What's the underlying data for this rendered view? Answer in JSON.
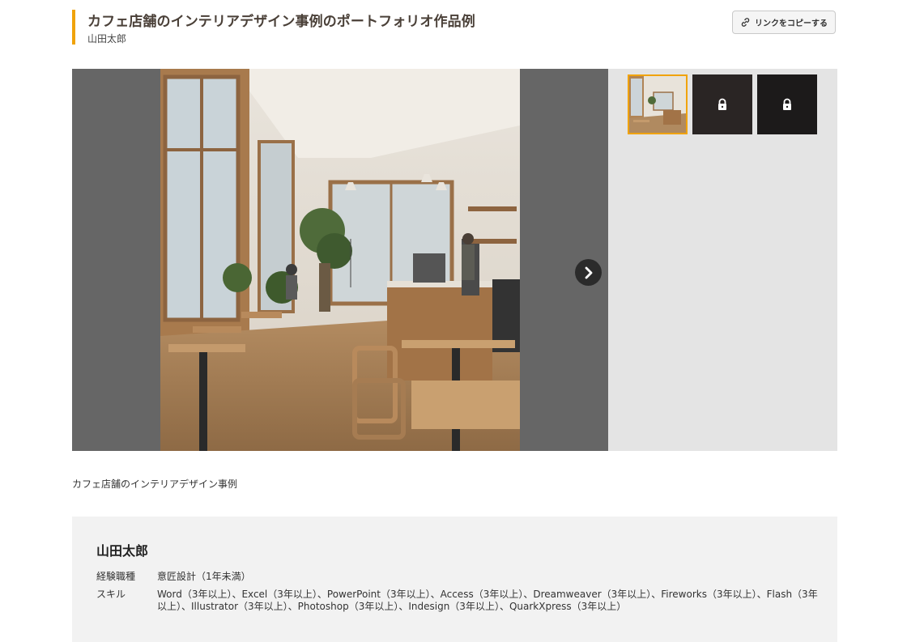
{
  "header": {
    "title": "カフェ店舗のインテリアデザイン事例のポートフォリオ作品例",
    "author": "山田太郎",
    "copy_link_label": "リンクをコピーする"
  },
  "gallery": {
    "main_image_icon": "cafe-interior-photo",
    "next_icon": "chevron-right-icon",
    "thumbnails": [
      {
        "state": "selected",
        "icon": "cafe-interior-thumbnail"
      },
      {
        "state": "locked",
        "icon": "lock-icon"
      },
      {
        "state": "locked",
        "icon": "lock-icon"
      }
    ]
  },
  "caption": "カフェ店舗のインテリアデザイン事例",
  "profile": {
    "name": "山田太郎",
    "experience_label": "経験職種",
    "experience_value": "意匠設計（1年未満）",
    "skills_label": "スキル",
    "skills_value": "Word（3年以上）、Excel（3年以上）、PowerPoint（3年以上）、Access（3年以上）、Dreamweaver（3年以上）、Fireworks（3年以上）、Flash（3年以上）、Illustrator（3年以上）、Photoshop（3年以上）、Indesign（3年以上）、QuarkXpress（3年以上）"
  },
  "colors": {
    "accent": "#f0a30a",
    "viewer_bg": "#666666",
    "thumb_panel_bg": "#e4e4e4",
    "profile_bg": "#f2f2f2"
  }
}
